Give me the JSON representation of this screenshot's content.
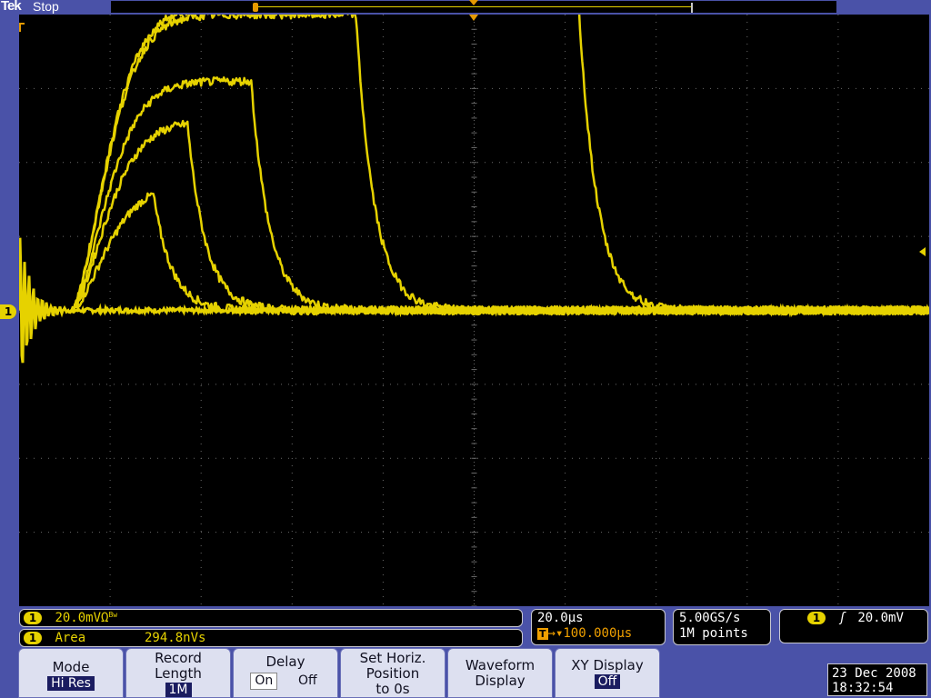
{
  "header": {
    "brand": "Tek",
    "run_state": "Stop"
  },
  "channel_marker": "1",
  "readouts": {
    "ch1_scale": {
      "channel": "1",
      "text": "20.0mVΩ",
      "bw_symbol": "Bw"
    },
    "measurement": {
      "channel": "1",
      "name": "Area",
      "value": "294.8nVs"
    },
    "timebase": {
      "scale": "20.0μs",
      "trigger_position": "100.000μs",
      "t_badge": "T"
    },
    "acquisition": {
      "sample_rate": "5.00GS/s",
      "record": "1M points"
    },
    "trigger": {
      "channel": "1",
      "slope_icon": "rising-edge",
      "level": "20.0mV"
    }
  },
  "menu": {
    "mode": {
      "label": "Mode",
      "value": "Hi Res"
    },
    "record_length": {
      "label_1": "Record",
      "label_2": "Length",
      "value": "1M"
    },
    "delay": {
      "label": "Delay",
      "on": "On",
      "off": "Off",
      "selected": "On"
    },
    "set_horiz": {
      "label_1": "Set Horiz.",
      "label_2": "Position",
      "label_3": "to 0s"
    },
    "waveform_display": {
      "label_1": "Waveform",
      "label_2": "Display"
    },
    "xy_display": {
      "label": "XY Display",
      "value": "Off"
    }
  },
  "datetime": {
    "date": "23 Dec  2008",
    "time": "18:32:54"
  },
  "colors": {
    "trace": "#e6d200",
    "background": "#000000",
    "frame": "#4a52a8"
  },
  "chart_data": {
    "type": "line",
    "xlabel": "",
    "ylabel": "",
    "x_unit": "μs",
    "y_unit": "mV",
    "x_divisions": 10,
    "y_divisions": 8,
    "xlim": [
      0,
      200
    ],
    "ylim": [
      -80,
      80
    ],
    "baseline_mV": 0,
    "series": [
      {
        "rise_start_us": 11.5,
        "peak_mV": 34,
        "fall_at_us": 29.5
      },
      {
        "rise_start_us": 11.5,
        "peak_mV": 51,
        "fall_at_us": 37.0
      },
      {
        "rise_start_us": 11.5,
        "peak_mV": 62,
        "fall_at_us": 51.0
      },
      {
        "rise_start_us": 11.5,
        "peak_mV": 80,
        "fall_at_us": 74.0
      },
      {
        "rise_start_us": 11.5,
        "peak_mV": 82,
        "fall_at_us": 123.0
      }
    ]
  }
}
